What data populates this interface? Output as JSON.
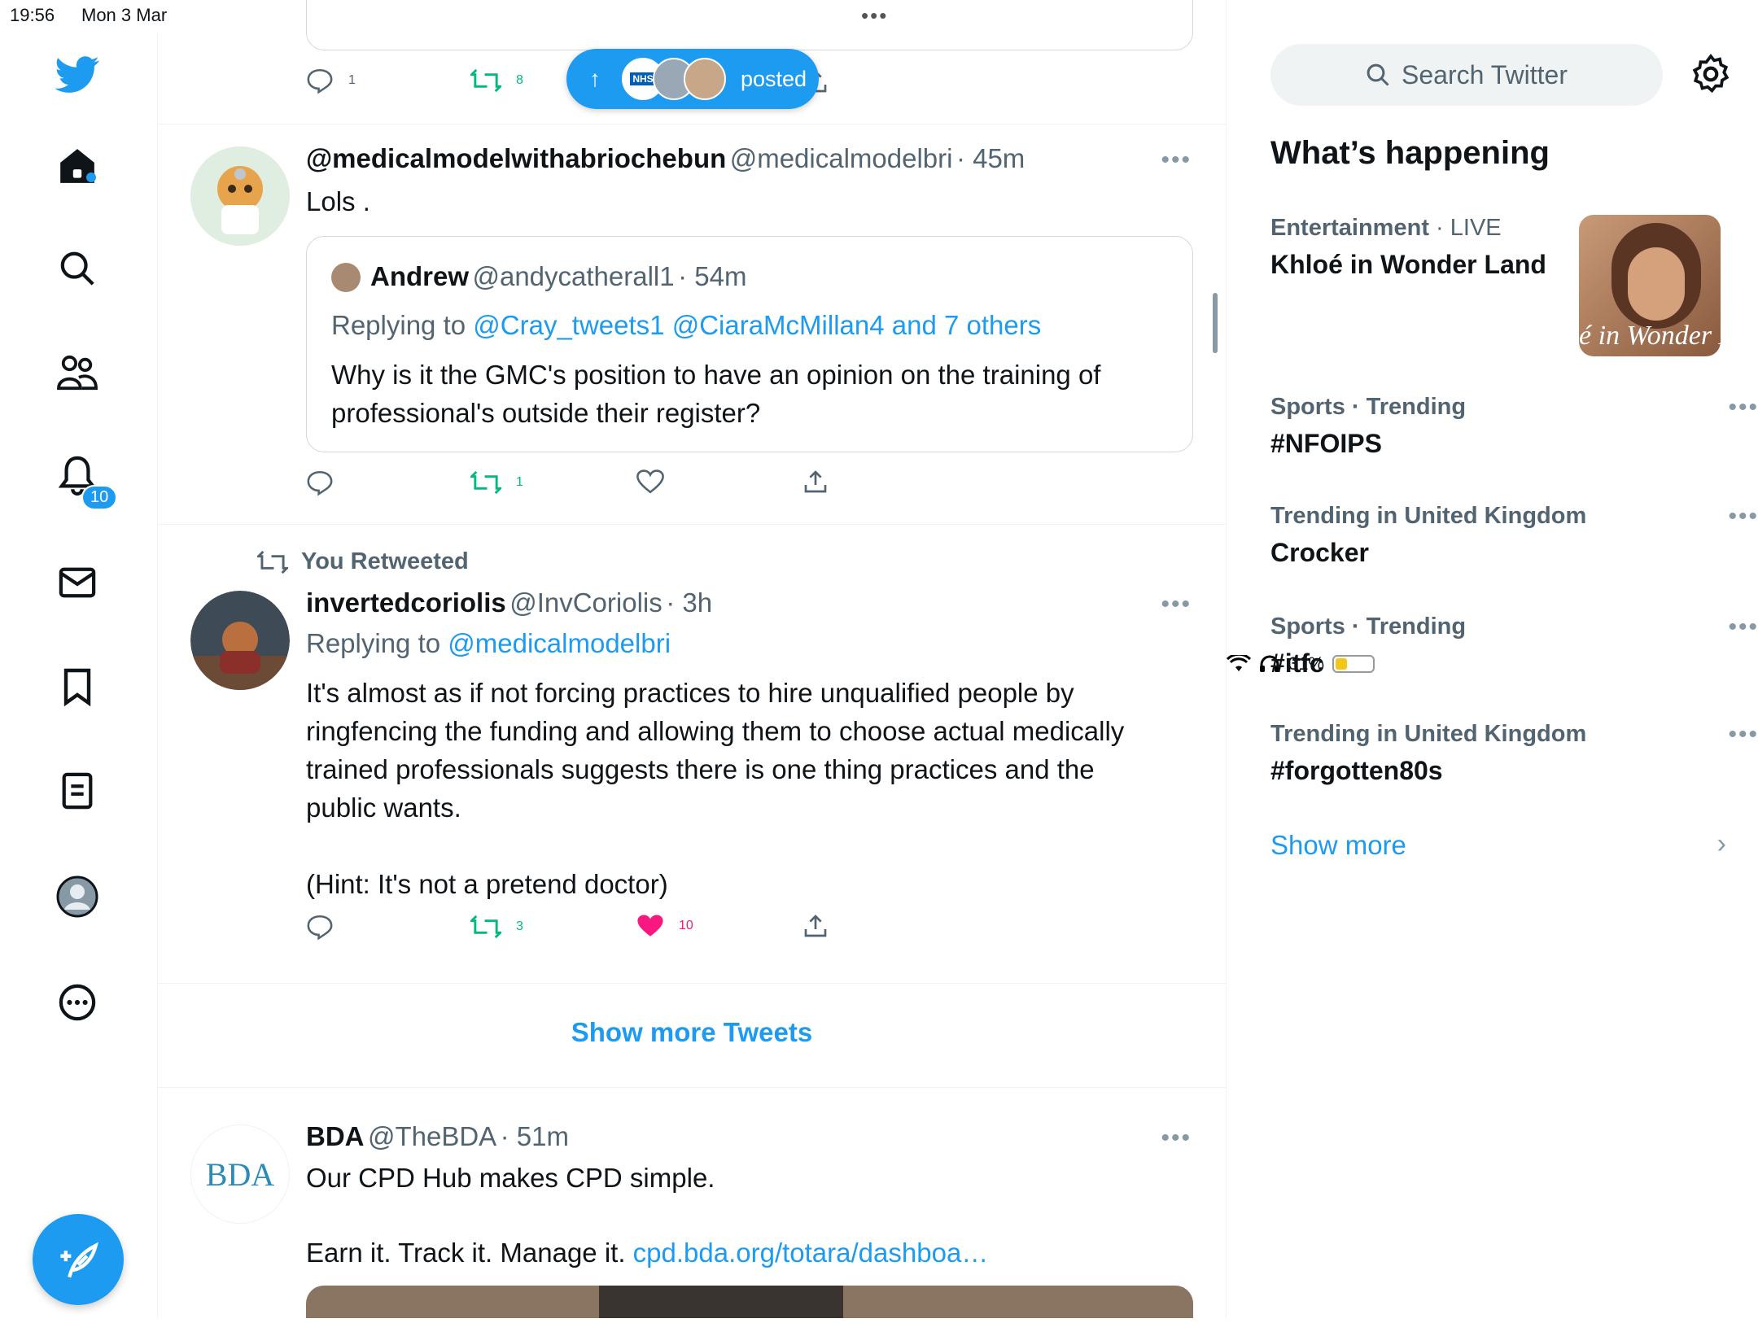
{
  "status_bar": {
    "time": "19:56",
    "date": "Mon 3 Mar",
    "battery": "31%"
  },
  "nav": {
    "notifications_badge": "10"
  },
  "feed": {
    "top_tweet": {
      "reply_count": "1",
      "retweet_count": "8"
    },
    "new_posts_pill": {
      "label": "posted"
    },
    "tweet1": {
      "name": "@medicalmodelwithabriochebun",
      "handle": "@medicalmodelbri",
      "time": "· 45m",
      "text": "Lols .",
      "quote": {
        "name": "Andrew",
        "handle": "@andycatherall1",
        "time": "· 54m",
        "replying_prefix": "Replying to ",
        "replying_to": "@Cray_tweets1 @CiaraMcMillan4 and 7 others",
        "text": "Why is it the GMC's position to have an opinion on the training of professional's outside their register?"
      },
      "retweet_count": "1"
    },
    "tweet2": {
      "context": "You Retweeted",
      "name": "invertedcoriolis",
      "handle": "@InvCoriolis",
      "time": "· 3h",
      "replying_prefix": "Replying to ",
      "replying_to": "@medicalmodelbri",
      "text": "It's almost as if not forcing practices to hire unqualified people by ringfencing the funding and allowing them to choose actual medically trained professionals suggests there is one thing practices and the public wants.\n\n(Hint: It's not a pretend doctor)",
      "retweet_count": "3",
      "like_count": "10"
    },
    "show_more_label": "Show more Tweets",
    "tweet3": {
      "name": "BDA",
      "handle": "@TheBDA",
      "time": "· 51m",
      "text_line1": "Our CPD Hub makes CPD simple.",
      "text_line2": "Earn it. Track it. Manage it. ",
      "link": "cpd.bda.org/totara/dashboa…",
      "logo_text": "BDA"
    }
  },
  "sidebar": {
    "search_placeholder": "Search Twitter",
    "whats_happening": "What’s happening",
    "trends": [
      {
        "category": "Entertainment",
        "meta": " · LIVE",
        "title": "Khloé in Wonder Land",
        "image_caption": "é in Wonder L"
      },
      {
        "category": "Sports · Trending",
        "title": "#NFOIPS"
      },
      {
        "category": "Trending in United Kingdom",
        "title": "Crocker"
      },
      {
        "category": "Sports · Trending",
        "title": "#itfc"
      },
      {
        "category": "Trending in United Kingdom",
        "title": "#forgotten80s"
      }
    ],
    "show_more": "Show more"
  },
  "colors": {
    "accent": "#1d9bf0",
    "retweet": "#00ba7c",
    "like": "#f91880"
  }
}
